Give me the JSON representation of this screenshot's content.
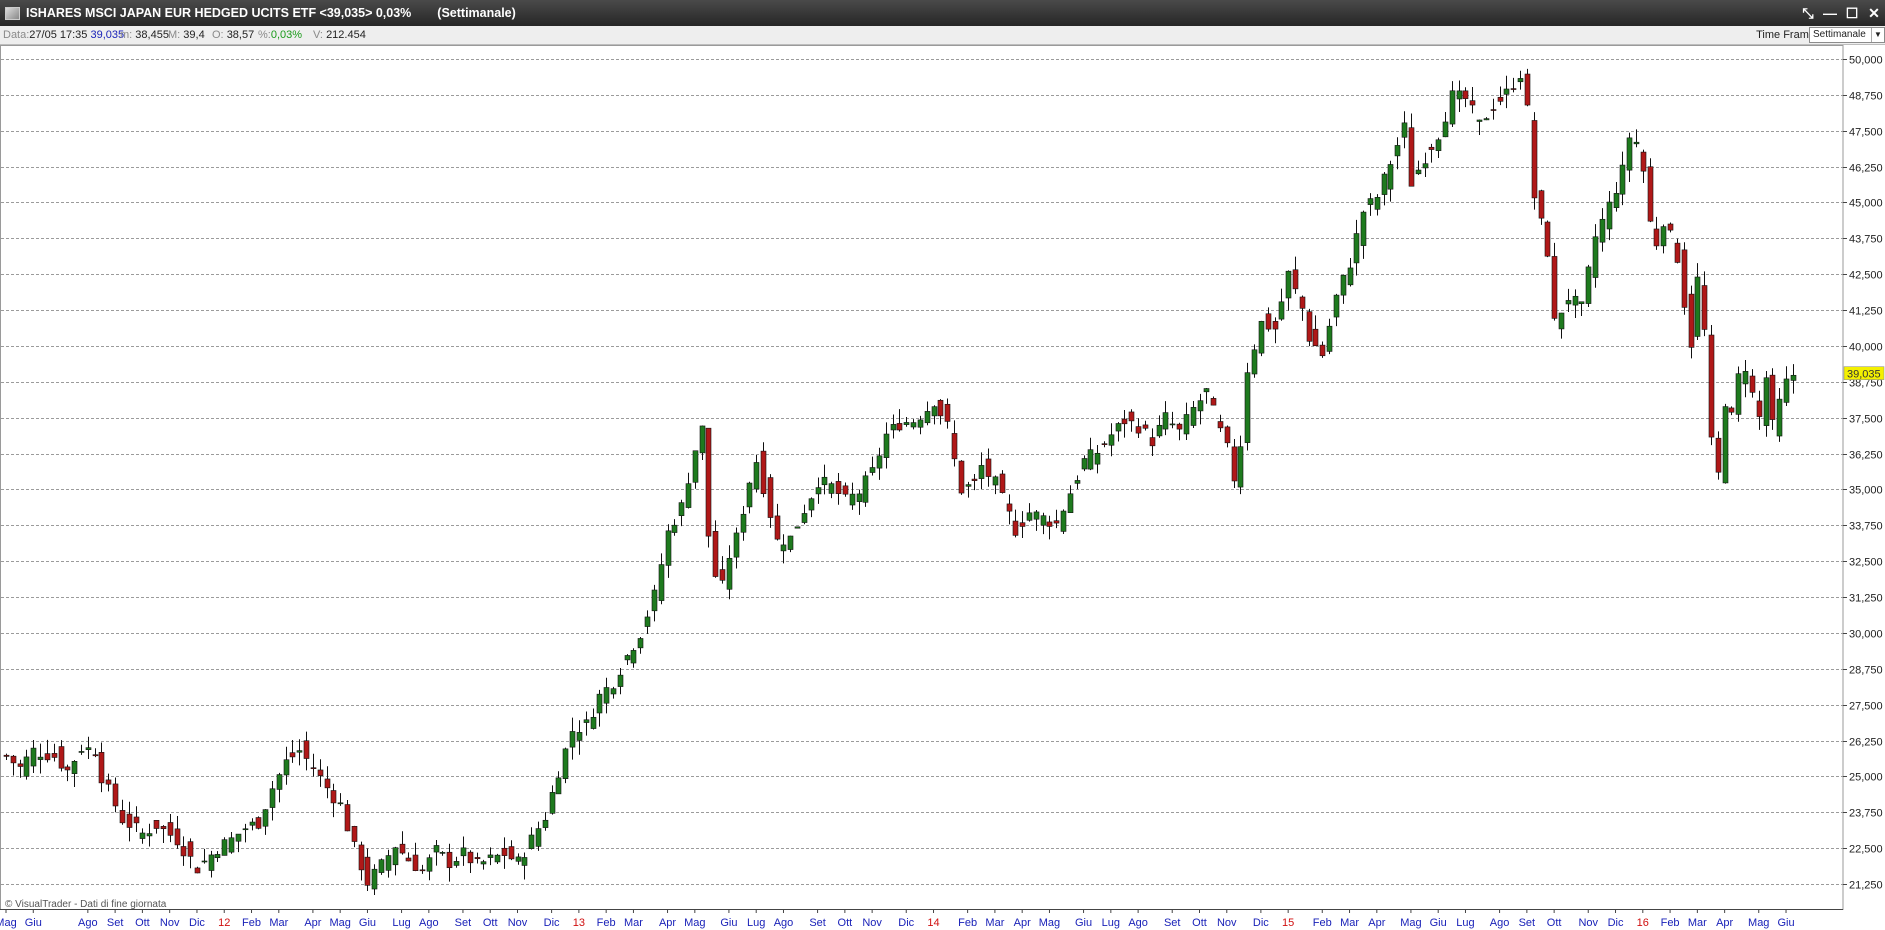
{
  "window": {
    "title": "ISHARES MSCI JAPAN EUR HEDGED UCITS ETF <39,035> 0,03%",
    "timeframe_title": "(Settimanale)",
    "buttons": [
      "⤡",
      "—",
      "☐",
      "✕"
    ]
  },
  "infobar": {
    "data_label": "Data:",
    "data_value": "27/05 17:35",
    "close_value": "39,035",
    "min_label": "m:",
    "min_value": "38,455",
    "max_label": "M:",
    "max_value": "39,4",
    "open_label": "O:",
    "open_value": "38,57",
    "pct_label": "%:",
    "pct_value": "0,03%",
    "vol_label": "V:",
    "vol_value": "212.454",
    "timeframe_label": "Time Frame",
    "timeframe_selected": "Settimanale"
  },
  "watermark": "© VisualTrader - Dati di fine giornata",
  "chart_data": {
    "type": "candlestick",
    "ylim": [
      20500,
      50250
    ],
    "y_ticks": [
      "50,000",
      "48,750",
      "47,500",
      "46,250",
      "45,000",
      "43,750",
      "42,500",
      "41,250",
      "40,000",
      "38,750",
      "37,500",
      "36,250",
      "35,000",
      "33,750",
      "32,500",
      "31,250",
      "30,000",
      "28,750",
      "27,500",
      "26,250",
      "25,000",
      "23,750",
      "22,500",
      "21,250"
    ],
    "last_price_label": "39,035",
    "last_price": 39035,
    "colors": {
      "up": "#1e7a1e",
      "down": "#b01818",
      "year_label": "#d01010",
      "month_label": "#1a22b8",
      "last_price_bg": "#f4f000"
    },
    "x_labels": [
      {
        "text": "Mag",
        "week": 0,
        "year": false
      },
      {
        "text": "Giu",
        "week": 4,
        "year": false
      },
      {
        "text": "Ago",
        "week": 12,
        "year": false
      },
      {
        "text": "Set",
        "week": 16,
        "year": false
      },
      {
        "text": "Ott",
        "week": 20,
        "year": false
      },
      {
        "text": "Nov",
        "week": 24,
        "year": false
      },
      {
        "text": "Dic",
        "week": 28,
        "year": false
      },
      {
        "text": "12",
        "week": 32,
        "year": true
      },
      {
        "text": "Feb",
        "week": 36,
        "year": false
      },
      {
        "text": "Mar",
        "week": 40,
        "year": false
      },
      {
        "text": "Apr",
        "week": 45,
        "year": false
      },
      {
        "text": "Mag",
        "week": 49,
        "year": false
      },
      {
        "text": "Giu",
        "week": 53,
        "year": false
      },
      {
        "text": "Lug",
        "week": 58,
        "year": false
      },
      {
        "text": "Ago",
        "week": 62,
        "year": false
      },
      {
        "text": "Set",
        "week": 67,
        "year": false
      },
      {
        "text": "Ott",
        "week": 71,
        "year": false
      },
      {
        "text": "Nov",
        "week": 75,
        "year": false
      },
      {
        "text": "Dic",
        "week": 80,
        "year": false
      },
      {
        "text": "13",
        "week": 84,
        "year": true
      },
      {
        "text": "Feb",
        "week": 88,
        "year": false
      },
      {
        "text": "Mar",
        "week": 92,
        "year": false
      },
      {
        "text": "Apr",
        "week": 97,
        "year": false
      },
      {
        "text": "Mag",
        "week": 101,
        "year": false
      },
      {
        "text": "Giu",
        "week": 106,
        "year": false
      },
      {
        "text": "Lug",
        "week": 110,
        "year": false
      },
      {
        "text": "Ago",
        "week": 114,
        "year": false
      },
      {
        "text": "Set",
        "week": 119,
        "year": false
      },
      {
        "text": "Ott",
        "week": 123,
        "year": false
      },
      {
        "text": "Nov",
        "week": 127,
        "year": false
      },
      {
        "text": "Dic",
        "week": 132,
        "year": false
      },
      {
        "text": "14",
        "week": 136,
        "year": true
      },
      {
        "text": "Feb",
        "week": 141,
        "year": false
      },
      {
        "text": "Mar",
        "week": 145,
        "year": false
      },
      {
        "text": "Apr",
        "week": 149,
        "year": false
      },
      {
        "text": "Mag",
        "week": 153,
        "year": false
      },
      {
        "text": "Giu",
        "week": 158,
        "year": false
      },
      {
        "text": "Lug",
        "week": 162,
        "year": false
      },
      {
        "text": "Ago",
        "week": 166,
        "year": false
      },
      {
        "text": "Set",
        "week": 171,
        "year": false
      },
      {
        "text": "Ott",
        "week": 175,
        "year": false
      },
      {
        "text": "Nov",
        "week": 179,
        "year": false
      },
      {
        "text": "Dic",
        "week": 184,
        "year": false
      },
      {
        "text": "15",
        "week": 188,
        "year": true
      },
      {
        "text": "Feb",
        "week": 193,
        "year": false
      },
      {
        "text": "Mar",
        "week": 197,
        "year": false
      },
      {
        "text": "Apr",
        "week": 201,
        "year": false
      },
      {
        "text": "Mag",
        "week": 206,
        "year": false
      },
      {
        "text": "Giu",
        "week": 210,
        "year": false
      },
      {
        "text": "Lug",
        "week": 214,
        "year": false
      },
      {
        "text": "Ago",
        "week": 219,
        "year": false
      },
      {
        "text": "Set",
        "week": 223,
        "year": false
      },
      {
        "text": "Ott",
        "week": 227,
        "year": false
      },
      {
        "text": "Nov",
        "week": 232,
        "year": false
      },
      {
        "text": "Dic",
        "week": 236,
        "year": false
      },
      {
        "text": "16",
        "week": 240,
        "year": true
      },
      {
        "text": "Feb",
        "week": 244,
        "year": false
      },
      {
        "text": "Mar",
        "week": 248,
        "year": false
      },
      {
        "text": "Apr",
        "week": 252,
        "year": false
      },
      {
        "text": "Mag",
        "week": 257,
        "year": false
      },
      {
        "text": "Giu",
        "week": 261,
        "year": false
      }
    ],
    "close_anchors": [
      [
        0,
        25700
      ],
      [
        2,
        25300
      ],
      [
        4,
        25900
      ],
      [
        7,
        25700
      ],
      [
        9,
        25200
      ],
      [
        11,
        26000
      ],
      [
        13,
        25900
      ],
      [
        14,
        25000
      ],
      [
        17,
        23500
      ],
      [
        20,
        23000
      ],
      [
        22,
        23300
      ],
      [
        25,
        22800
      ],
      [
        28,
        21800
      ],
      [
        31,
        22500
      ],
      [
        33,
        22800
      ],
      [
        35,
        23200
      ],
      [
        37,
        23400
      ],
      [
        39,
        24600
      ],
      [
        41,
        25500
      ],
      [
        43,
        25900
      ],
      [
        45,
        25300
      ],
      [
        47,
        24600
      ],
      [
        49,
        24000
      ],
      [
        51,
        22500
      ],
      [
        53,
        21300
      ],
      [
        55,
        21900
      ],
      [
        57,
        22600
      ],
      [
        59,
        22100
      ],
      [
        61,
        21700
      ],
      [
        63,
        22400
      ],
      [
        65,
        22000
      ],
      [
        67,
        22300
      ],
      [
        69,
        21900
      ],
      [
        71,
        22100
      ],
      [
        73,
        22300
      ],
      [
        75,
        22000
      ],
      [
        77,
        22800
      ],
      [
        79,
        23600
      ],
      [
        81,
        25200
      ],
      [
        83,
        26600
      ],
      [
        85,
        26800
      ],
      [
        87,
        27800
      ],
      [
        89,
        28300
      ],
      [
        91,
        29200
      ],
      [
        93,
        30000
      ],
      [
        95,
        31300
      ],
      [
        97,
        33500
      ],
      [
        99,
        34400
      ],
      [
        101,
        36400
      ],
      [
        102,
        37100
      ],
      [
        103,
        33400
      ],
      [
        104,
        32000
      ],
      [
        105,
        31600
      ],
      [
        106,
        32700
      ],
      [
        107,
        33300
      ],
      [
        109,
        35300
      ],
      [
        110,
        36000
      ],
      [
        111,
        35100
      ],
      [
        113,
        33200
      ],
      [
        115,
        33300
      ],
      [
        117,
        34300
      ],
      [
        119,
        35300
      ],
      [
        121,
        35100
      ],
      [
        123,
        34600
      ],
      [
        125,
        34900
      ],
      [
        127,
        35600
      ],
      [
        129,
        36900
      ],
      [
        131,
        37300
      ],
      [
        133,
        37400
      ],
      [
        135,
        37800
      ],
      [
        136,
        38100
      ],
      [
        138,
        37200
      ],
      [
        139,
        36000
      ],
      [
        140,
        35000
      ],
      [
        142,
        35200
      ],
      [
        143,
        35800
      ],
      [
        145,
        35200
      ],
      [
        147,
        34100
      ],
      [
        148,
        33600
      ],
      [
        150,
        34200
      ],
      [
        152,
        34000
      ],
      [
        154,
        33800
      ],
      [
        156,
        34900
      ],
      [
        158,
        36000
      ],
      [
        160,
        36300
      ],
      [
        162,
        36900
      ],
      [
        164,
        37400
      ],
      [
        166,
        37200
      ],
      [
        168,
        36700
      ],
      [
        170,
        37500
      ],
      [
        172,
        37000
      ],
      [
        174,
        37800
      ],
      [
        176,
        38400
      ],
      [
        178,
        37000
      ],
      [
        179,
        36400
      ],
      [
        180,
        35400
      ],
      [
        181,
        36600
      ],
      [
        182,
        39200
      ],
      [
        184,
        40800
      ],
      [
        186,
        40600
      ],
      [
        188,
        42500
      ],
      [
        190,
        41300
      ],
      [
        191,
        40300
      ],
      [
        193,
        39700
      ],
      [
        195,
        41700
      ],
      [
        197,
        42900
      ],
      [
        199,
        44700
      ],
      [
        201,
        45200
      ],
      [
        203,
        46400
      ],
      [
        205,
        47600
      ],
      [
        206,
        45700
      ],
      [
        208,
        46600
      ],
      [
        210,
        47400
      ],
      [
        212,
        48700
      ],
      [
        214,
        48600
      ],
      [
        216,
        47700
      ],
      [
        218,
        48400
      ],
      [
        220,
        48800
      ],
      [
        222,
        49500
      ],
      [
        223,
        48200
      ],
      [
        224,
        45200
      ],
      [
        226,
        43300
      ],
      [
        227,
        40800
      ],
      [
        229,
        41700
      ],
      [
        231,
        41300
      ],
      [
        233,
        43800
      ],
      [
        235,
        44900
      ],
      [
        237,
        46100
      ],
      [
        238,
        47300
      ],
      [
        239,
        47100
      ],
      [
        240,
        46100
      ],
      [
        241,
        44300
      ],
      [
        242,
        43600
      ],
      [
        243,
        44400
      ],
      [
        244,
        43800
      ],
      [
        245,
        43100
      ],
      [
        246,
        41500
      ],
      [
        247,
        40100
      ],
      [
        248,
        42300
      ],
      [
        249,
        40500
      ],
      [
        250,
        36600
      ],
      [
        251,
        35500
      ],
      [
        252,
        38100
      ],
      [
        253,
        37500
      ],
      [
        254,
        38900
      ],
      [
        255,
        39300
      ],
      [
        256,
        38300
      ],
      [
        257,
        37500
      ],
      [
        258,
        38900
      ],
      [
        259,
        37200
      ],
      [
        260,
        38000
      ],
      [
        261,
        38700
      ],
      [
        262,
        39000
      ]
    ]
  }
}
